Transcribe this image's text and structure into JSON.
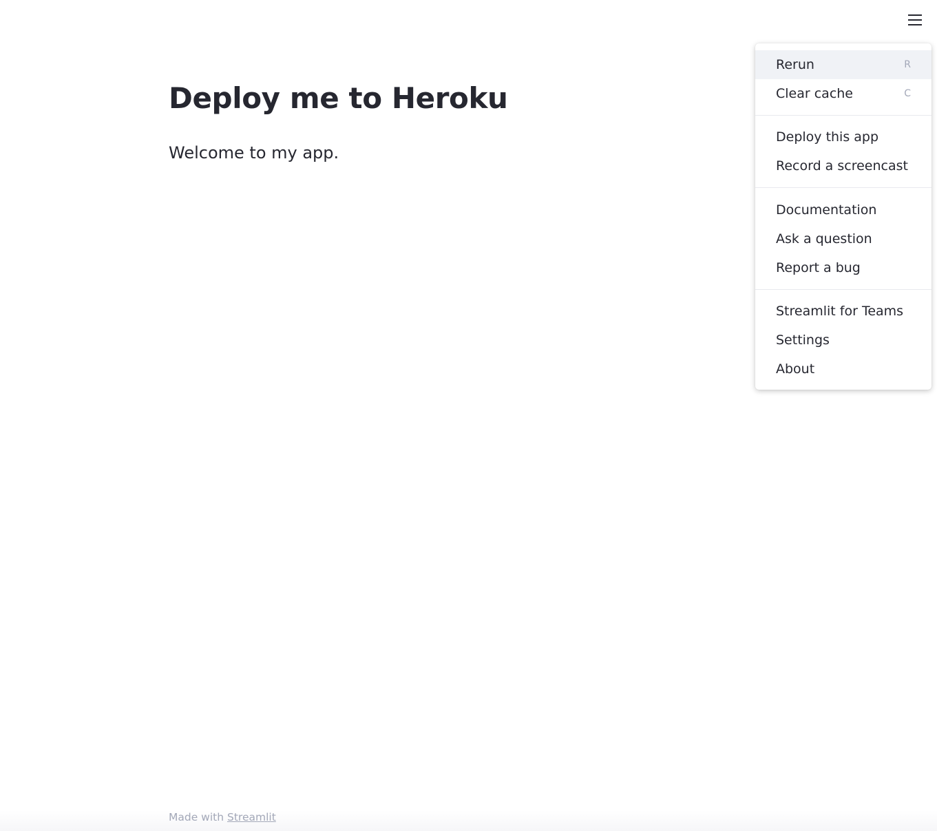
{
  "header": {
    "menu_icon": "hamburger-icon"
  },
  "main": {
    "title": "Deploy me to Heroku",
    "subtitle": "Welcome to my app."
  },
  "footer": {
    "made_with": "Made with ",
    "link": "Streamlit"
  },
  "menu": {
    "rerun": {
      "label": "Rerun",
      "shortcut": "R"
    },
    "clear_cache": {
      "label": "Clear cache",
      "shortcut": "C"
    },
    "deploy": {
      "label": "Deploy this app"
    },
    "screencast": {
      "label": "Record a screencast"
    },
    "documentation": {
      "label": "Documentation"
    },
    "ask": {
      "label": "Ask a question"
    },
    "bug": {
      "label": "Report a bug"
    },
    "teams": {
      "label": "Streamlit for Teams"
    },
    "settings": {
      "label": "Settings"
    },
    "about": {
      "label": "About"
    }
  },
  "colors": {
    "text": "#262730",
    "muted": "#a3a8b8",
    "hover": "#f0f2f6"
  }
}
